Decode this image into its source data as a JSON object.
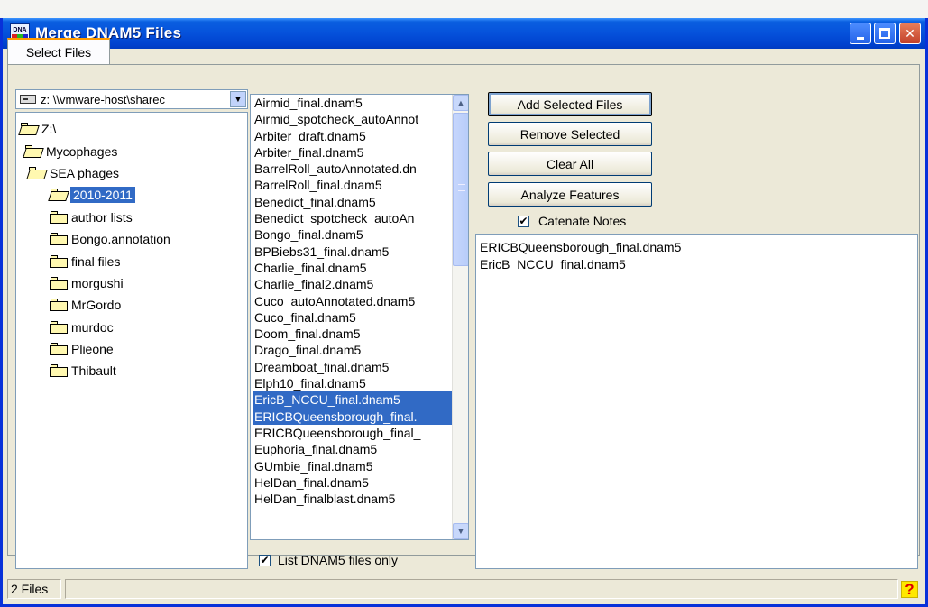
{
  "window": {
    "title": "Merge DNAM5 Files",
    "app_icon_text": "DNA"
  },
  "tabs": [
    {
      "label": "Select Files",
      "active": true
    }
  ],
  "drive_combo": {
    "value": "z: \\\\vmware-host\\sharec"
  },
  "folders": [
    {
      "label": "Z:\\",
      "state": "open"
    },
    {
      "label": "Mycophages",
      "state": "open"
    },
    {
      "label": "SEA phages",
      "state": "open"
    },
    {
      "label": "2010-2011",
      "state": "open",
      "selected": true
    },
    {
      "label": "author lists",
      "state": "closed"
    },
    {
      "label": "Bongo.annotation",
      "state": "closed"
    },
    {
      "label": "final files",
      "state": "closed"
    },
    {
      "label": "morgushi",
      "state": "closed"
    },
    {
      "label": "MrGordo",
      "state": "closed"
    },
    {
      "label": "murdoc",
      "state": "closed"
    },
    {
      "label": "Plieone",
      "state": "closed"
    },
    {
      "label": "Thibault",
      "state": "closed"
    }
  ],
  "files": [
    {
      "name": "Airmid_final.dnam5"
    },
    {
      "name": "Airmid_spotcheck_autoAnnot"
    },
    {
      "name": "Arbiter_draft.dnam5"
    },
    {
      "name": "Arbiter_final.dnam5"
    },
    {
      "name": "BarrelRoll_autoAnnotated.dn"
    },
    {
      "name": "BarrelRoll_final.dnam5"
    },
    {
      "name": "Benedict_final.dnam5"
    },
    {
      "name": "Benedict_spotcheck_autoAn"
    },
    {
      "name": "Bongo_final.dnam5"
    },
    {
      "name": "BPBiebs31_final.dnam5"
    },
    {
      "name": "Charlie_final.dnam5"
    },
    {
      "name": "Charlie_final2.dnam5"
    },
    {
      "name": "Cuco_autoAnnotated.dnam5"
    },
    {
      "name": "Cuco_final.dnam5"
    },
    {
      "name": "Doom_final.dnam5"
    },
    {
      "name": "Drago_final.dnam5"
    },
    {
      "name": "Dreamboat_final.dnam5"
    },
    {
      "name": "Elph10_final.dnam5"
    },
    {
      "name": "EricB_NCCU_final.dnam5",
      "selected": true
    },
    {
      "name": "ERICBQueensborough_final.",
      "selected": true
    },
    {
      "name": "ERICBQueensborough_final_"
    },
    {
      "name": "Euphoria_final.dnam5"
    },
    {
      "name": "GUmbie_final.dnam5"
    },
    {
      "name": "HelDan_final.dnam5"
    },
    {
      "name": "HelDan_finalblast.dnam5"
    }
  ],
  "list_only": {
    "label": "List DNAM5 files only",
    "checked": true,
    "mark": "✔"
  },
  "buttons": {
    "add": "Add Selected Files",
    "remove": "Remove Selected",
    "clear": "Clear All",
    "analyze": "Analyze Features"
  },
  "catenate": {
    "label": "Catenate Notes",
    "checked": true,
    "mark": "✔"
  },
  "selected_files": [
    "ERICBQueensborough_final.dnam5",
    "EricB_NCCU_final.dnam5"
  ],
  "status": {
    "text": "2 Files",
    "help_glyph": "?"
  },
  "icons": {
    "minimize": "minimize-icon",
    "maximize": "maximize-icon",
    "close": "close-icon",
    "close_glyph": "✕",
    "dropdown_glyph": "▼",
    "scroll_up_glyph": "▲",
    "scroll_down_glyph": "▼"
  },
  "colors": {
    "titlebar": "#0653dc",
    "selection": "#316ac5",
    "face": "#ece9d8",
    "tab_highlight": "#ff9a00"
  }
}
